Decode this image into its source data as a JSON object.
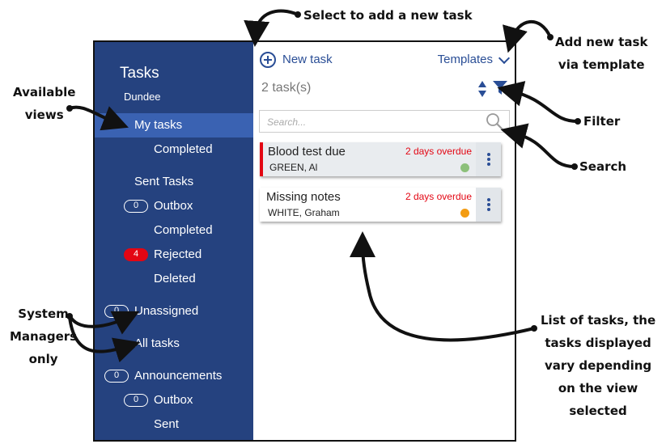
{
  "sidebar": {
    "title": "Tasks",
    "subtitle": "Dundee",
    "items": [
      {
        "label": "My tasks",
        "active": true
      },
      {
        "label": "Completed"
      },
      {
        "label": "Sent Tasks"
      },
      {
        "label": "Outbox",
        "count": "0"
      },
      {
        "label": "Completed"
      },
      {
        "label": "Rejected",
        "count": "4"
      },
      {
        "label": "Deleted"
      },
      {
        "label": "Unassigned",
        "count": "0"
      },
      {
        "label": "All tasks"
      },
      {
        "label": "Announcements",
        "count": "0"
      },
      {
        "label": "Outbox",
        "count": "0"
      },
      {
        "label": "Sent"
      }
    ]
  },
  "toolbar": {
    "new_task_label": "New task",
    "templates_label": "Templates"
  },
  "task_count": "2 task(s)",
  "search": {
    "placeholder": "Search..."
  },
  "tasks": [
    {
      "title": "Blood test due",
      "patient": "GREEN, Al",
      "due": "2 days overdue",
      "status_color": "#8cc07a"
    },
    {
      "title": "Missing notes",
      "patient": "WHITE, Graham",
      "due": "2 days overdue",
      "status_color": "#f39c12"
    }
  ],
  "colors": {
    "sidebar": "#25427f",
    "sidebar_active": "#3a62b2",
    "accent": "#2a4e96",
    "overdue": "#e30613"
  },
  "annotations": {
    "new_task": "Select to add a new task",
    "template": [
      "Add new task",
      "via template"
    ],
    "views": [
      "Available",
      "views"
    ],
    "filter": "Filter",
    "search": "Search",
    "managers": [
      "System",
      "Managers",
      "only"
    ],
    "list": [
      "List of tasks, the",
      "tasks displayed",
      "vary depending",
      "on the view",
      "selected"
    ]
  }
}
